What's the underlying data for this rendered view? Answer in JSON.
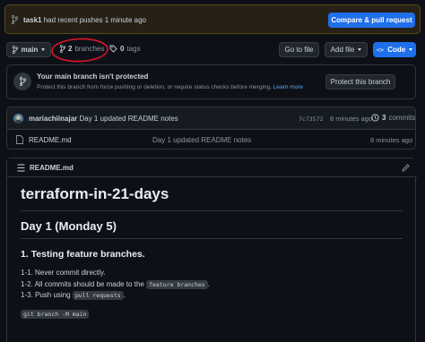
{
  "banner": {
    "branch": "task1",
    "message": "had recent pushes 1 minute ago",
    "cta": "Compare & pull request"
  },
  "toolbar": {
    "branch": "main",
    "branches_count": "2",
    "branches_label": "branches",
    "tags_count": "0",
    "tags_label": "tags",
    "goto_file": "Go to file",
    "add_file": "Add file",
    "code": "Code"
  },
  "protect": {
    "title": "Your main branch isn't protected",
    "desc": "Protect this branch from force pushing or deletion, or require status checks before merging.",
    "link": "Learn more",
    "button": "Protect this branch"
  },
  "commit": {
    "author": "mariachiinajar",
    "message": "Day 1 updated README notes",
    "sha": "7c73572",
    "time": "8 minutes ago",
    "commits_count": "3",
    "commits_label": "commits"
  },
  "files": [
    {
      "name": "README.md",
      "message": "Day 1 updated README notes",
      "time": "8 minutes ago"
    }
  ],
  "readme": {
    "header": "README.md",
    "h1": "terraform-in-21-days",
    "h2": "Day 1 (Monday 5)",
    "h3": "1. Testing feature branches.",
    "line1": "1-1. Never commit directly.",
    "line2_pre": "1-2. All commits should be made to the",
    "line2_code": "feature branches",
    "line2_post": ".",
    "line3_pre": "1-3. Push using",
    "line3_code": "pull requests",
    "line3_post": ".",
    "code_block": "git branch -M main"
  },
  "colors": {
    "background": "#0d1117",
    "banner_bg": "#272115",
    "accent_blue": "#1f6feb",
    "annotation_red": "#e0142a",
    "link": "#58a6ff"
  }
}
